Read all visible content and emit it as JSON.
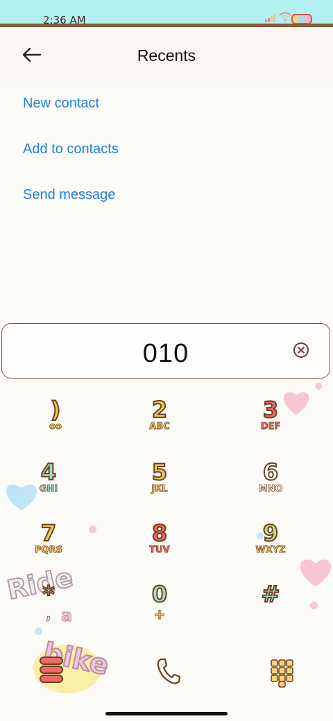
{
  "status_bar": {
    "time": "2:36 AM"
  },
  "header": {
    "title": "Recents"
  },
  "actions": [
    {
      "label": "New contact"
    },
    {
      "label": "Add to contacts"
    },
    {
      "label": "Send message"
    }
  ],
  "dialer": {
    "number": "010"
  },
  "keypad": [
    {
      "digit": ")",
      "letters": "oo"
    },
    {
      "digit": "2",
      "letters": "ABC"
    },
    {
      "digit": "3",
      "letters": "DEF"
    },
    {
      "digit": "4",
      "letters": "GHI"
    },
    {
      "digit": "5",
      "letters": "JKL"
    },
    {
      "digit": "6",
      "letters": "MNO"
    },
    {
      "digit": "7",
      "letters": "PQRS"
    },
    {
      "digit": "8",
      "letters": "TUV"
    },
    {
      "digit": "9",
      "letters": "WXYZ"
    },
    {
      "digit": "*",
      "letters": ","
    },
    {
      "digit": "0",
      "letters": "+"
    },
    {
      "digit": "#",
      "letters": ""
    }
  ],
  "decor": {
    "sticker_text_1": "Ride",
    "sticker_text_2": "a",
    "sticker_text_3": "bike"
  },
  "colors": {
    "accent": "#1d7fe0",
    "status_bar": "#b3f0f2",
    "border": "#8a5a3c"
  }
}
